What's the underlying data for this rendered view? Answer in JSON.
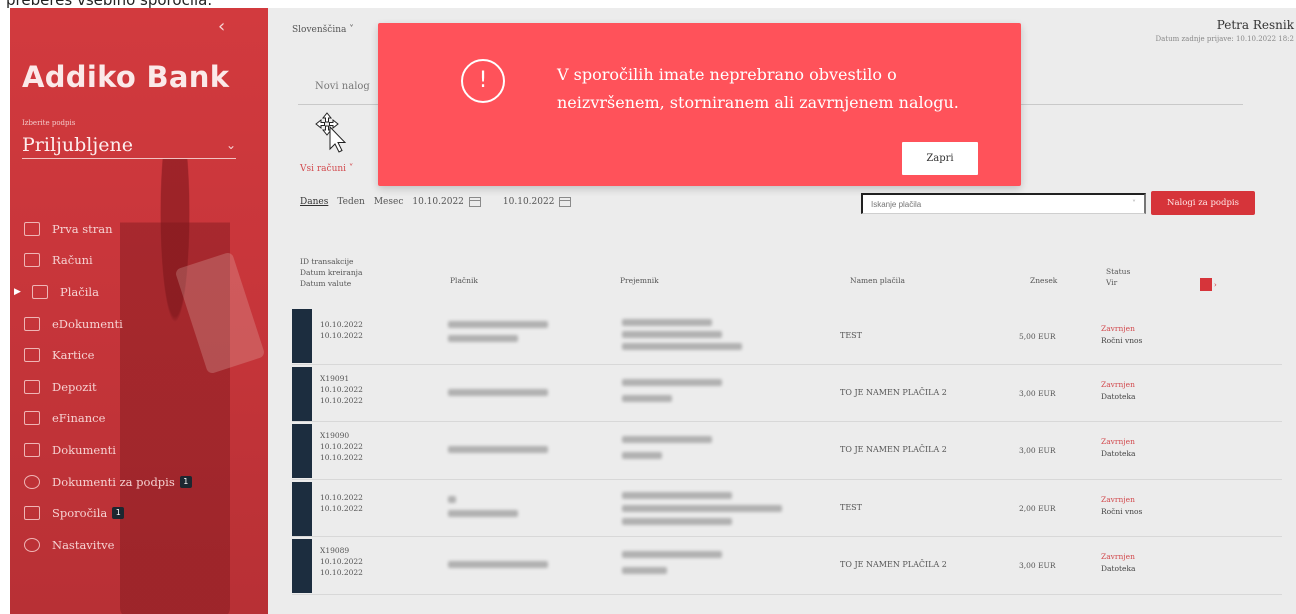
{
  "top_cut_text": "prebereš vsebino sporočila.",
  "sidebar": {
    "logo": "Addiko Bank",
    "signature_label": "Izberite podpis",
    "signature_value": "Priljubljene",
    "items": [
      {
        "label": "Prva stran",
        "icon": "home-icon"
      },
      {
        "label": "Računi",
        "icon": "accounts-icon"
      },
      {
        "label": "Plačila",
        "icon": "payments-icon",
        "active": true
      },
      {
        "label": "eDokumenti",
        "icon": "folder-icon"
      },
      {
        "label": "Kartice",
        "icon": "card-icon"
      },
      {
        "label": "Depozit",
        "icon": "deposit-icon"
      },
      {
        "label": "eFinance",
        "icon": "efinance-icon"
      },
      {
        "label": "Dokumenti",
        "icon": "folder-icon"
      },
      {
        "label": "Dokumenti za podpis",
        "icon": "signature-icon",
        "badge": "1"
      },
      {
        "label": "Sporočila",
        "icon": "messages-icon",
        "badge": "1"
      },
      {
        "label": "Nastavitve",
        "icon": "gear-icon"
      }
    ]
  },
  "header": {
    "language": "Slovenščina",
    "user_name": "Petra Resnik",
    "last_login": "Datum zadnje prijave: 10.10.2022 18:2"
  },
  "tabs": {
    "new_order": "Novi nalog"
  },
  "accounts_filter": "Vsi računi",
  "filters": {
    "today": "Danes",
    "week": "Teden",
    "month": "Mesec",
    "date_from": "10.10.2022",
    "date_to": "10.10.2022"
  },
  "search": {
    "placeholder": "Iskanje plačila"
  },
  "sign_button": "Nalogi za podpis",
  "table": {
    "headers": {
      "id": [
        "ID transakcije",
        "Datum kreiranja",
        "Datum valute"
      ],
      "payer": "Plačnik",
      "recipient": "Prejemnik",
      "purpose": "Namen plačila",
      "amount": "Znesek",
      "status": [
        "Status",
        "Vir"
      ]
    },
    "rows": [
      {
        "id_lines": [
          "10.10.2022",
          "10.10.2022"
        ],
        "purpose": "TEST",
        "amount": "5,00 EUR",
        "status": "Zavrnjen",
        "source": "Ročni vnos"
      },
      {
        "id_lines": [
          "X19091",
          "10.10.2022",
          "10.10.2022"
        ],
        "purpose": "TO JE NAMEN PLAČILA 2",
        "amount": "3,00 EUR",
        "status": "Zavrnjen",
        "source": "Datoteka"
      },
      {
        "id_lines": [
          "X19090",
          "10.10.2022",
          "10.10.2022"
        ],
        "purpose": "TO JE NAMEN PLAČILA 2",
        "amount": "3,00 EUR",
        "status": "Zavrnjen",
        "source": "Datoteka"
      },
      {
        "id_lines": [
          "10.10.2022",
          "10.10.2022"
        ],
        "purpose": "TEST",
        "amount": "2,00 EUR",
        "status": "Zavrnjen",
        "source": "Ročni vnos"
      },
      {
        "id_lines": [
          "X19089",
          "10.10.2022",
          "10.10.2022"
        ],
        "purpose": "TO JE NAMEN PLAČILA 2",
        "amount": "3,00 EUR",
        "status": "Zavrnjen",
        "source": "Datoteka"
      }
    ]
  },
  "modal": {
    "message": "V sporočilih imate neprebrano obvestilo o neizvršenem, storniranem ali zavrnjenem nalogu.",
    "close_label": "Zapri",
    "icon": "alert-icon"
  },
  "colors": {
    "brand_red": "#d23a3e",
    "modal_bg": "#ff525a",
    "row_marker": "#1c2d3f",
    "status_red": "#d24a4e"
  }
}
